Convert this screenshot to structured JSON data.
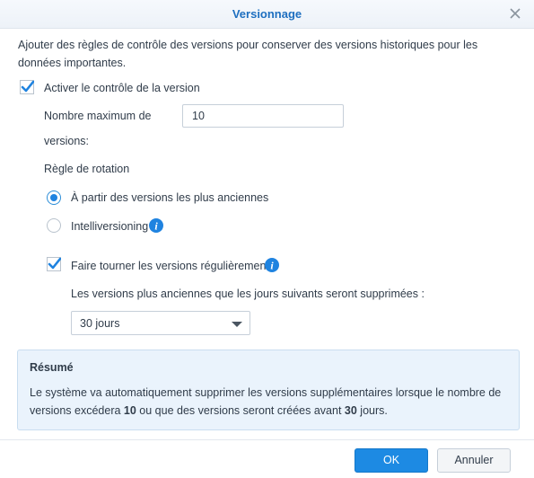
{
  "dialog": {
    "title": "Versionnage"
  },
  "intro": "Ajouter des règles de contrôle des versions pour conserver des versions historiques pour les données importantes.",
  "enable": {
    "label": "Activer le contrôle de la version",
    "checked": true
  },
  "max_versions": {
    "label_line1": "Nombre maximum de",
    "label_line2": "versions:",
    "value": "10"
  },
  "rotation": {
    "label": "Règle de rotation",
    "options": [
      {
        "label": "À partir des versions les plus anciennes",
        "selected": true
      },
      {
        "label": "Intelliversioning",
        "selected": false
      }
    ]
  },
  "periodic": {
    "label": "Faire tourner les versions régulièrement",
    "checked": true
  },
  "older": {
    "label": "Les versions plus anciennes que les jours suivants seront supprimées :",
    "value": "30 jours"
  },
  "summary": {
    "title": "Résumé",
    "text_before": "Le système va automatiquement supprimer les versions supplémentaires lorsque le nombre de versions excédera ",
    "count": "10",
    "text_middle": " ou que des versions seront créées avant ",
    "days": "30",
    "text_after": " jours."
  },
  "buttons": {
    "ok": "OK",
    "cancel": "Annuler"
  },
  "colors": {
    "accent": "#1d8ae3",
    "title": "#1e6fc0",
    "summary_bg": "#eaf3fc"
  }
}
